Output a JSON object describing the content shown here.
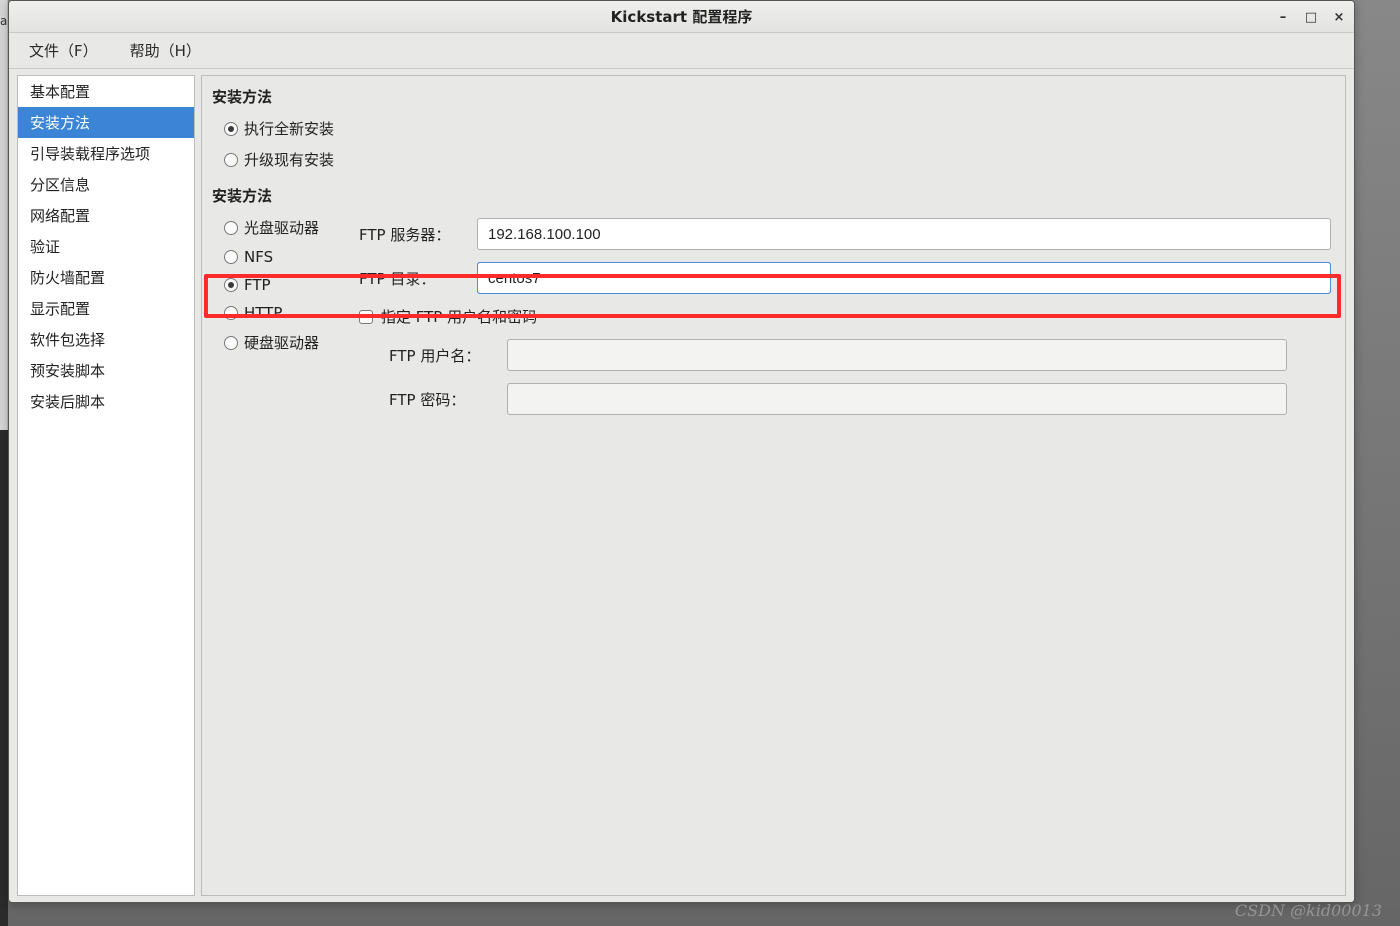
{
  "window": {
    "title": "Kickstart 配置程序"
  },
  "menubar": {
    "file": "文件（F）",
    "help": "帮助（H）"
  },
  "sidebar": {
    "items": [
      {
        "label": "基本配置"
      },
      {
        "label": "安装方法"
      },
      {
        "label": "引导装载程序选项"
      },
      {
        "label": "分区信息"
      },
      {
        "label": "网络配置"
      },
      {
        "label": "验证"
      },
      {
        "label": "防火墙配置"
      },
      {
        "label": "显示配置"
      },
      {
        "label": "软件包选择"
      },
      {
        "label": "预安装脚本"
      },
      {
        "label": "安装后脚本"
      }
    ],
    "selected_index": 1
  },
  "main": {
    "section1_title": "安装方法",
    "install_type": {
      "fresh_label": "执行全新安装",
      "upgrade_label": "升级现有安装",
      "selected": "fresh"
    },
    "section2_title": "安装方法",
    "method_options": {
      "cdrom": "光盘驱动器",
      "nfs": "NFS",
      "ftp": "FTP",
      "http": "HTTP",
      "hdd": "硬盘驱动器",
      "selected": "ftp"
    },
    "ftp": {
      "server_label": "FTP 服务器：",
      "server_value": "192.168.100.100",
      "dir_label": "FTP 目录：",
      "dir_value": "centos7",
      "auth_checkbox_label": "指定 FTP 用户名和密码",
      "auth_checked": false,
      "user_label": "FTP 用户名：",
      "user_value": "",
      "pass_label": "FTP 密码：",
      "pass_value": ""
    }
  },
  "watermark": "CSDN @kid00013"
}
